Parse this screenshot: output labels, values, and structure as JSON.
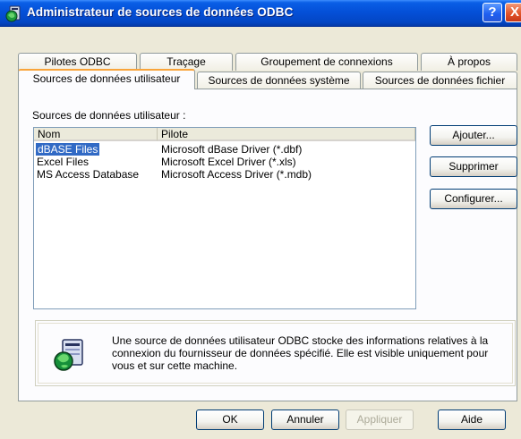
{
  "window": {
    "title": "Administrateur de sources de données ODBC",
    "help_label": "?",
    "close_label": "X"
  },
  "tabs": {
    "row1": [
      "Pilotes ODBC",
      "Traçage",
      "Groupement de connexions",
      "À propos"
    ],
    "row2": [
      "Sources de données utilisateur",
      "Sources de données système",
      "Sources de données fichier"
    ],
    "active": "Sources de données utilisateur"
  },
  "panel": {
    "section_label": "Sources de données utilisateur :",
    "columns": [
      "Nom",
      "Pilote"
    ],
    "rows": [
      {
        "nom": "dBASE Files",
        "pilote": "Microsoft dBase Driver (*.dbf)",
        "selected": true
      },
      {
        "nom": "Excel Files",
        "pilote": "Microsoft Excel Driver (*.xls)",
        "selected": false
      },
      {
        "nom": "MS Access Database",
        "pilote": "Microsoft Access Driver (*.mdb)",
        "selected": false
      }
    ],
    "buttons": {
      "add": "Ajouter...",
      "remove": "Supprimer",
      "configure": "Configurer..."
    },
    "info_text": "Une source de données utilisateur ODBC stocke des informations relatives à la connexion du fournisseur de données spécifié. Elle est visible uniquement pour vous et sur cette machine."
  },
  "footer": {
    "ok": "OK",
    "cancel": "Annuler",
    "apply": "Appliquer",
    "help": "Aide"
  },
  "icons": [
    "odbc-app-icon",
    "globe-database-icon"
  ],
  "colors": {
    "titlebar": "#0450d8",
    "selection": "#316ac5",
    "tab_accent": "#f9a43a",
    "dialog_bg": "#ece9d8"
  }
}
